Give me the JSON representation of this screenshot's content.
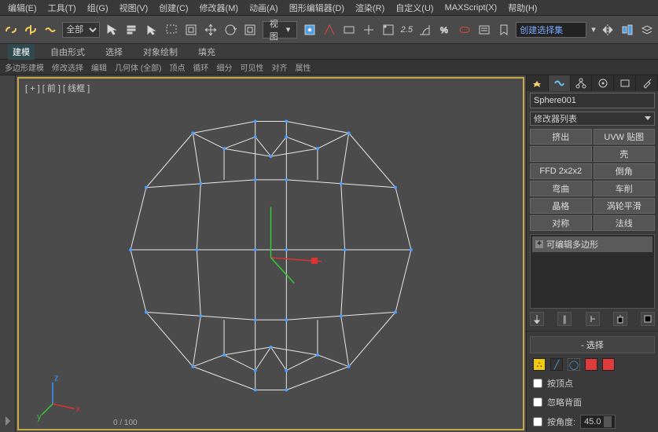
{
  "menu": [
    "编辑(E)",
    "工具(T)",
    "组(G)",
    "视图(V)",
    "创建(C)",
    "修改器(M)",
    "动画(A)",
    "图形编辑器(D)",
    "渲染(R)",
    "自定义(U)",
    "MAXScript(X)",
    "帮助(H)"
  ],
  "toolbar": {
    "filter_dd": "全部",
    "view_dd": "视图",
    "spinner": "2.5",
    "sel_set": "创建选择集"
  },
  "ribbon_tabs": [
    "建模",
    "自由形式",
    "选择",
    "对象绘制",
    "填充"
  ],
  "ribbon_row": [
    "多边形建模",
    "修改选择",
    "编辑",
    "几何体 (全部)",
    "顶点",
    "循环",
    "细分",
    "可见性",
    "对齐",
    "属性"
  ],
  "viewport": {
    "label": "[ + ] [ 前 ] [ 线框 ]",
    "frame": "0 / 100"
  },
  "panel": {
    "object_name": "Sphere001",
    "mod_dd": "修改器列表",
    "buttons": [
      "挤出",
      "UVW 贴图",
      "",
      "壳",
      "FFD 2x2x2",
      "倒角",
      "弯曲",
      "车削",
      "晶格",
      "涡轮平滑",
      "对称",
      "法线"
    ],
    "stack_item": "可编辑多边形",
    "section": {
      "minus": "-",
      "title": "选择",
      "by_vertex": "按顶点",
      "ignore_back": "忽略背面",
      "by_angle": "按角度:",
      "angle_val": "45.0"
    },
    "colors": {
      "yellow": "#f2cc0c",
      "red": "#e03a3a",
      "blue": "#2c6fd1"
    }
  }
}
